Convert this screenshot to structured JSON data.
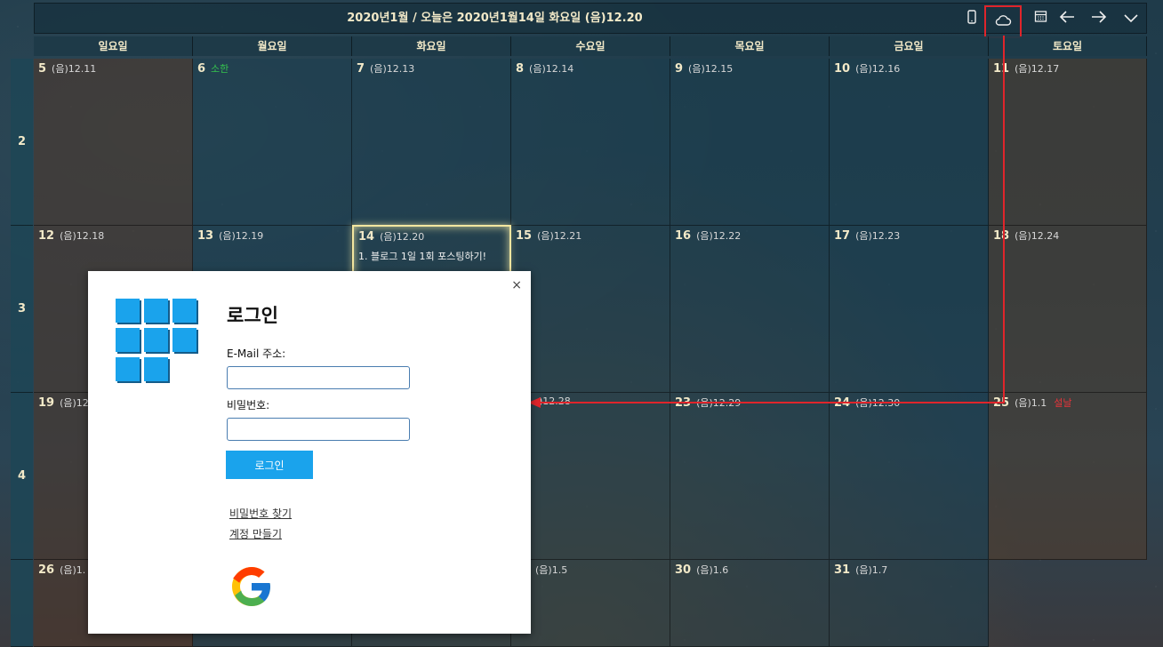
{
  "header": {
    "title": "2020년1월 / 오늘은 2020년1월14일 화요일 (음)12.20",
    "buttons": [
      {
        "name": "phone-icon"
      },
      {
        "name": "cloud-icon"
      },
      {
        "name": "calendar-grid-icon"
      },
      {
        "name": "arrow-left-icon"
      },
      {
        "name": "arrow-right-icon"
      },
      {
        "name": "chevron-down-icon"
      }
    ]
  },
  "weekdays": [
    "일요일",
    "월요일",
    "화요일",
    "수요일",
    "목요일",
    "금요일",
    "토요일"
  ],
  "weeks": [
    {
      "week_no": "2",
      "days": [
        {
          "day": "5",
          "lunar": "(음)12.11"
        },
        {
          "day": "6",
          "holiday": "소한"
        },
        {
          "day": "7",
          "lunar": "(음)12.13"
        },
        {
          "day": "8",
          "lunar": "(음)12.14"
        },
        {
          "day": "9",
          "lunar": "(음)12.15"
        },
        {
          "day": "10",
          "lunar": "(음)12.16"
        },
        {
          "day": "11",
          "lunar": "(음)12.17"
        }
      ]
    },
    {
      "week_no": "3",
      "days": [
        {
          "day": "12",
          "lunar": "(음)12.18"
        },
        {
          "day": "13",
          "lunar": "(음)12.19"
        },
        {
          "day": "14",
          "lunar": "(음)12.20",
          "event": "1. 블로그 1일 1회 포스팅하기!"
        },
        {
          "day": "15",
          "lunar": "(음)12.21"
        },
        {
          "day": "16",
          "lunar": "(음)12.22"
        },
        {
          "day": "17",
          "lunar": "(음)12.23"
        },
        {
          "day": "18",
          "lunar": "(음)12.24"
        }
      ]
    },
    {
      "week_no": "4",
      "days": [
        {
          "day": "19",
          "lunar": "(음)12"
        },
        {
          "day": "",
          "lunar": ""
        },
        {
          "day": "",
          "lunar": ""
        },
        {
          "day": "",
          "lunar": ")12.28"
        },
        {
          "day": "23",
          "lunar": "(음)12.29"
        },
        {
          "day": "24",
          "lunar": "(음)12.30"
        },
        {
          "day": "25",
          "lunar": "(음)1.1",
          "holiday_red": "설날"
        }
      ]
    },
    {
      "week_no": "",
      "days": [
        {
          "day": "26",
          "lunar": "(음)1."
        },
        {
          "day": "",
          "lunar": ""
        },
        {
          "day": "",
          "lunar": ""
        },
        {
          "day": "",
          "lunar": "(음)1.5"
        },
        {
          "day": "30",
          "lunar": "(음)1.6"
        },
        {
          "day": "31",
          "lunar": "(음)1.7"
        }
      ]
    }
  ],
  "login": {
    "title": "로그인",
    "email_label": "E-Mail 주소:",
    "email_value": "",
    "password_label": "비밀번호:",
    "password_value": "",
    "submit_label": "로그인",
    "find_password": "비밀번호 찾기",
    "create_account": "계정 만들기",
    "close_glyph": "×"
  },
  "colors": {
    "accent": "#1aa3ec",
    "highlight": "#e0252b",
    "today_glow": "#f3e6a0"
  }
}
